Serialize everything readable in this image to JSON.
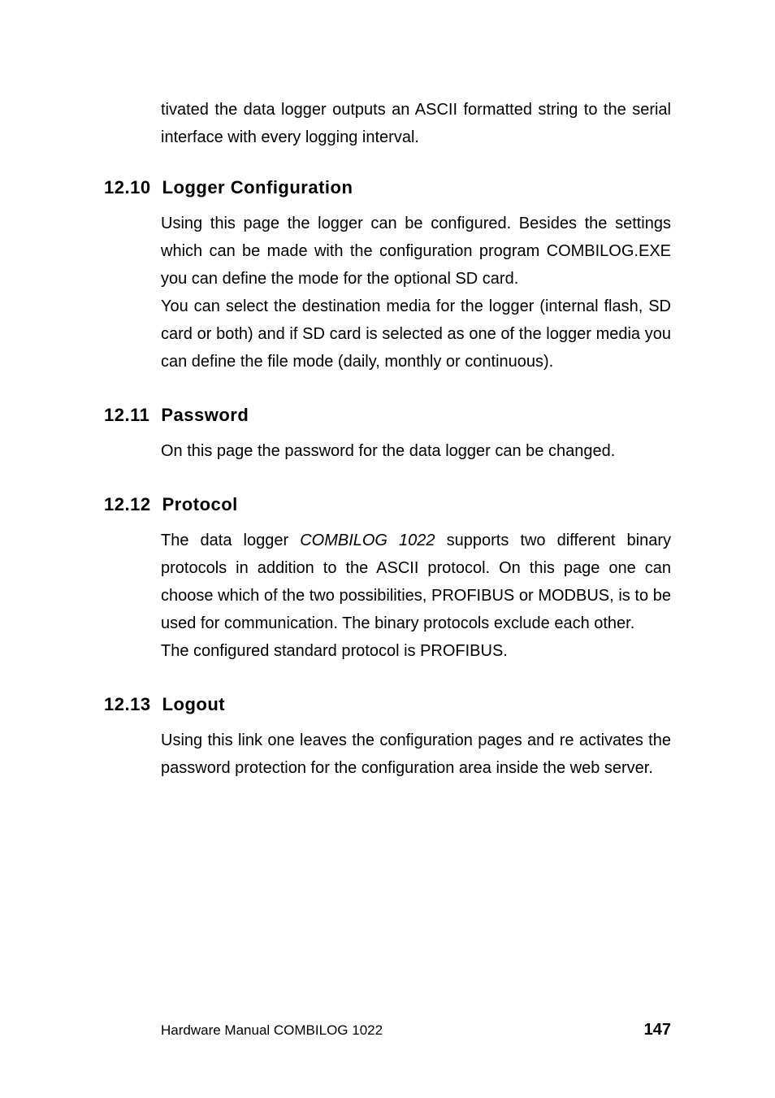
{
  "intro_text": "tivated the data logger outputs an ASCII formatted string to the serial interface with every logging interval.",
  "sections": [
    {
      "number": "12.10",
      "title": "Logger Configuration",
      "paragraphs": [
        "Using this page the logger can be configured. Besides the settings which can be made with the configuration program COMBILOG.EXE you can define the mode for the optional SD card.",
        "You can select the destination media for the logger (internal flash, SD card or both) and if SD card is selected as one of the logger media you can define the file mode (daily, monthly or continuous)."
      ]
    },
    {
      "number": "12.11",
      "title": "Password",
      "paragraphs": [
        "On this page the password for the data logger can be changed."
      ]
    },
    {
      "number": "12.12",
      "title": "Protocol",
      "paragraphs_html": [
        "The data logger <em class=\"book-italic\">COMBILOG 1022</em> supports two different binary protocols in addition to the ASCII protocol. On this page one can choose which of the two possibilities, PROFIBUS or MODBUS, is to be used for communication. The binary protocols exclude each other.",
        "The configured standard protocol is PROFIBUS."
      ]
    },
    {
      "number": "12.13",
      "title": "Logout",
      "paragraphs": [
        "Using this link one leaves the configuration pages and re activates the password protection for the configuration area inside the web server."
      ]
    }
  ],
  "footer": {
    "left": "Hardware Manual COMBILOG 1022",
    "right": "147"
  }
}
